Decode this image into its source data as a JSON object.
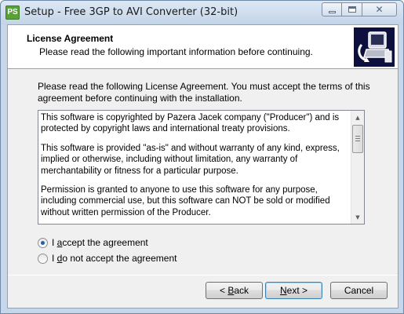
{
  "window": {
    "title": "Setup - Free 3GP to AVI Converter (32-bit)",
    "app_icon_text": "PS",
    "close_glyph": "✕"
  },
  "header": {
    "title": "License Agreement",
    "subtitle": "Please read the following important information before continuing."
  },
  "intro": "Please read the following License Agreement. You must accept the terms of this agreement before continuing with the installation.",
  "license": {
    "paragraphs": [
      "This software is copyrighted by Pazera Jacek company (\"Producer\") and is protected by copyright laws and international treaty provisions.",
      "This software is provided \"as-is\" and without warranty of any kind, express, implied or otherwise, including without limitation, any warranty of merchantability or fitness for a particular purpose.",
      "Permission is granted to anyone to use this software for any purpose, including commercial use, but this software can NOT be sold or modified without written permission of the Producer."
    ]
  },
  "options": {
    "accept": {
      "pre": "I ",
      "key": "a",
      "post": "ccept the agreement",
      "selected": true
    },
    "decline": {
      "pre": "I ",
      "key": "d",
      "post": "o not accept the agreement",
      "selected": false
    }
  },
  "buttons": {
    "back": {
      "pre": "< ",
      "key": "B",
      "post": "ack"
    },
    "next": {
      "pre": "",
      "key": "N",
      "post": "ext >"
    },
    "cancel": "Cancel"
  },
  "colors": {
    "logo_background": "#0d0f3c",
    "radio_dot": "#2b5ea9",
    "app_icon": "#5aa13a"
  }
}
